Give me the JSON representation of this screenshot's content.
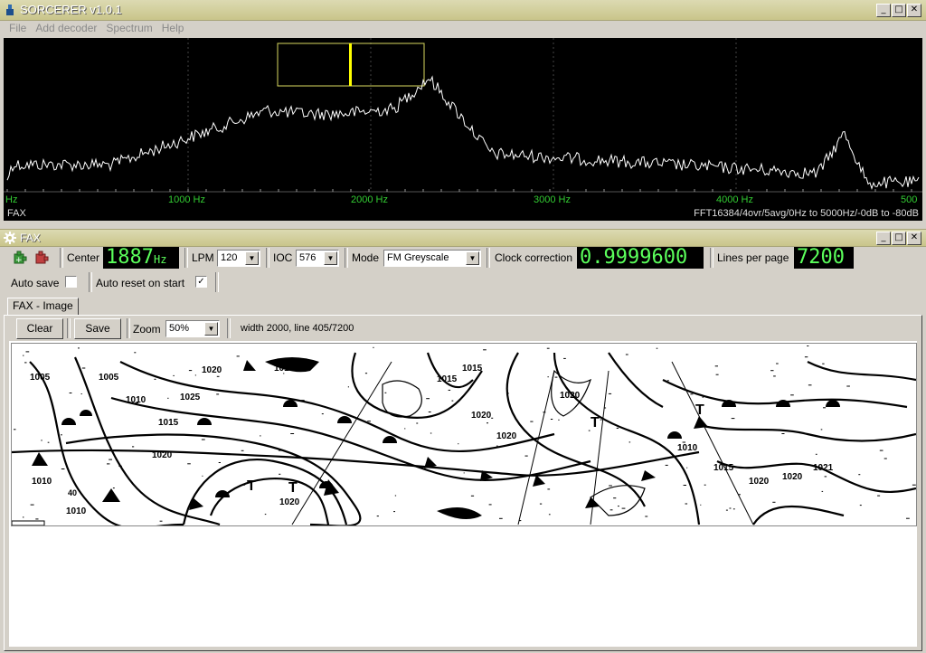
{
  "window": {
    "title": "SORCERER v1.0.1",
    "buttons": [
      "_",
      "□",
      "✕"
    ]
  },
  "menu": [
    "File",
    "Add decoder",
    "Spectrum",
    "Help"
  ],
  "spectrum": {
    "left_edge_label": "Hz",
    "freq_labels": [
      "1000 Hz",
      "2000 Hz",
      "3000 Hz",
      "4000 Hz",
      "500"
    ],
    "mode_label": "FAX",
    "info": "FFT16384/4ovr/5avg/0Hz to 5000Hz/-0dB to -80dB",
    "colors": {
      "trace": "#ffffff",
      "axis_text": "#33cc33",
      "marker": "#ffff00",
      "bandwidth_box": "#d8d860"
    }
  },
  "fax": {
    "title": "FAX",
    "center_label": "Center",
    "center_value": "1887",
    "center_unit": "Hz",
    "lpm_label": "LPM",
    "lpm_value": "120",
    "ioc_label": "IOC",
    "ioc_value": "576",
    "mode_label": "Mode",
    "mode_value": "FM Greyscale",
    "clock_label": "Clock correction",
    "clock_value": "0.9999600",
    "lpp_label": "Lines per page",
    "lpp_value": "7200",
    "autosave_label": "Auto save",
    "autoreset_label": "Auto reset on start",
    "autoreset_checked": "✓",
    "tab_label": "FAX - Image",
    "clear_label": "Clear",
    "save_label": "Save",
    "zoom_label": "Zoom",
    "zoom_value": "50%",
    "status": "width 2000, line 405/7200"
  },
  "weather_map": {
    "pressure_labels": [
      "1005",
      "1010",
      "1020",
      "1025",
      "1015",
      "1020",
      "1010",
      "1020",
      "1015",
      "1020",
      "1020",
      "1010",
      "1015",
      "1020",
      "1020",
      "1005",
      "1010",
      "1010",
      "1015",
      "1020",
      "1021",
      "40"
    ],
    "high_markers": [
      "T",
      "T",
      "T",
      "T"
    ]
  }
}
